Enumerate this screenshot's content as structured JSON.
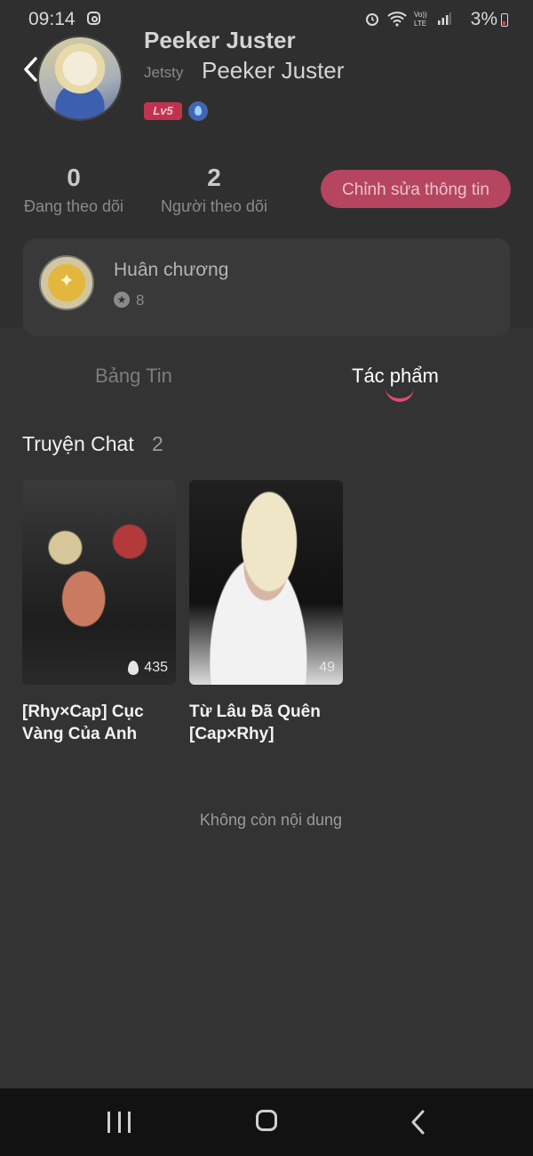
{
  "status_bar": {
    "time": "09:14",
    "battery": "3%",
    "icons": [
      "instagram-icon",
      "alarm-icon",
      "wifi-icon",
      "volte-icon",
      "signal-icon",
      "battery-icon"
    ]
  },
  "profile": {
    "display_name": "Peeker Juster",
    "app_label": "Jetsty",
    "username": "Peeker Juster",
    "level": "Lv5"
  },
  "stats": {
    "following_count": "0",
    "following_label": "Đang theo dõi",
    "followers_count": "2",
    "followers_label": "Người theo dõi"
  },
  "edit_button": "Chỉnh sửa thông tin",
  "medals": {
    "title": "Huân chương",
    "count": "8"
  },
  "tabs": [
    {
      "label": "Bảng Tin",
      "active": false
    },
    {
      "label": "Tác phẩm",
      "active": true
    }
  ],
  "section": {
    "title": "Truyện Chat",
    "count": "2"
  },
  "works": [
    {
      "title": "[Rhy×Cap] Cục Vàng Của Anh",
      "views": "435"
    },
    {
      "title": "Từ Lâu Đã Quên [Cap×Rhy]",
      "views": "49"
    }
  ],
  "end_message": "Không còn nội dung",
  "colors": {
    "background": "#333333",
    "accent": "#e24a6c",
    "edit_button": "#b64560",
    "level_badge": "#c0334f"
  }
}
